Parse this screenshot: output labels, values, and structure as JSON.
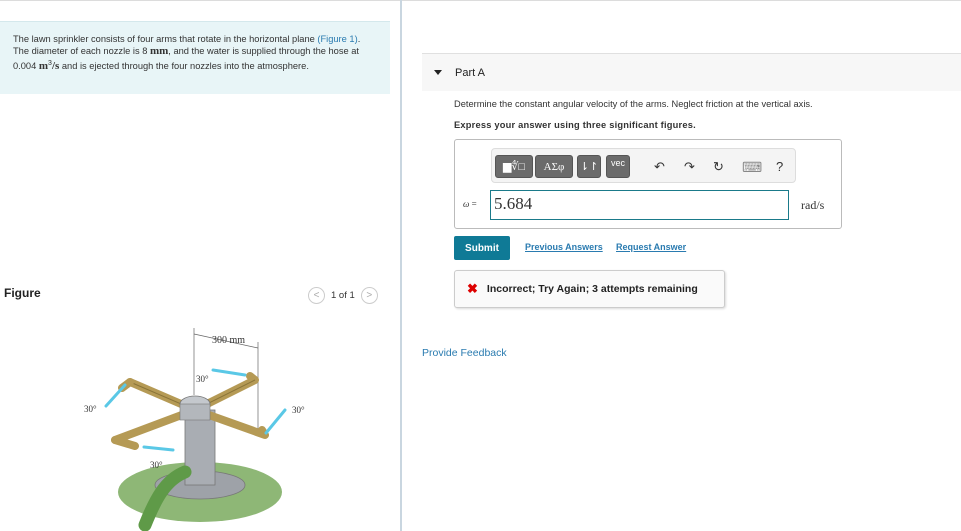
{
  "problem": {
    "text_before_link": "The lawn sprinkler consists of four arms that rotate in the horizontal plane",
    "figure_link": "(Figure 1)",
    "text_diameter": ". The diameter of each nozzle is 8 ",
    "unit_mm": "mm",
    "text_supply": ", and the water is supplied through the hose at 0.004 ",
    "unit_m": "m",
    "unit_exp": "3",
    "unit_per_s": "/s",
    "text_end": " and is ejected through the four nozzles into the atmosphere."
  },
  "figure": {
    "header": "Figure",
    "pager_text": "1 of 1",
    "prev_icon": "chevron-left-icon",
    "next_icon": "chevron-right-icon",
    "dimension_label": "300 mm",
    "angle_labels": [
      "30°",
      "30°",
      "30°",
      "30°"
    ],
    "colors": {
      "arm": "#b59a55",
      "jet": "#5ac8e6",
      "post": "#a9adb3",
      "ground": "#7aaa5e",
      "hose": "#5f9a48"
    }
  },
  "part": {
    "label": "Part A",
    "question": "Determine the constant angular velocity of the arms. Neglect friction at the vertical axis.",
    "instruction": "Express your answer using three significant figures."
  },
  "toolbar": {
    "templates_label": "▆∜□",
    "greek_label": "ΑΣφ",
    "arrows_label": "⇂↾",
    "vec_label": "vec",
    "undo_icon": "↶",
    "redo_icon": "↷",
    "reset_icon": "↻",
    "keyboard_icon": "⌨",
    "help_label": "?"
  },
  "answer": {
    "variable": "ω",
    "equals": "=",
    "value": "5.684",
    "units": "rad/s"
  },
  "actions": {
    "submit": "Submit",
    "previous_answers": "Previous Answers",
    "request_answer": "Request Answer"
  },
  "feedback": {
    "icon": "✖",
    "message": "Incorrect; Try Again; 3 attempts remaining"
  },
  "provide_feedback": "Provide Feedback",
  "colors": {
    "accent": "#0f7a96",
    "link": "#2a7bb0",
    "error": "#dd0000",
    "problem_bg": "#e8f5f7"
  }
}
